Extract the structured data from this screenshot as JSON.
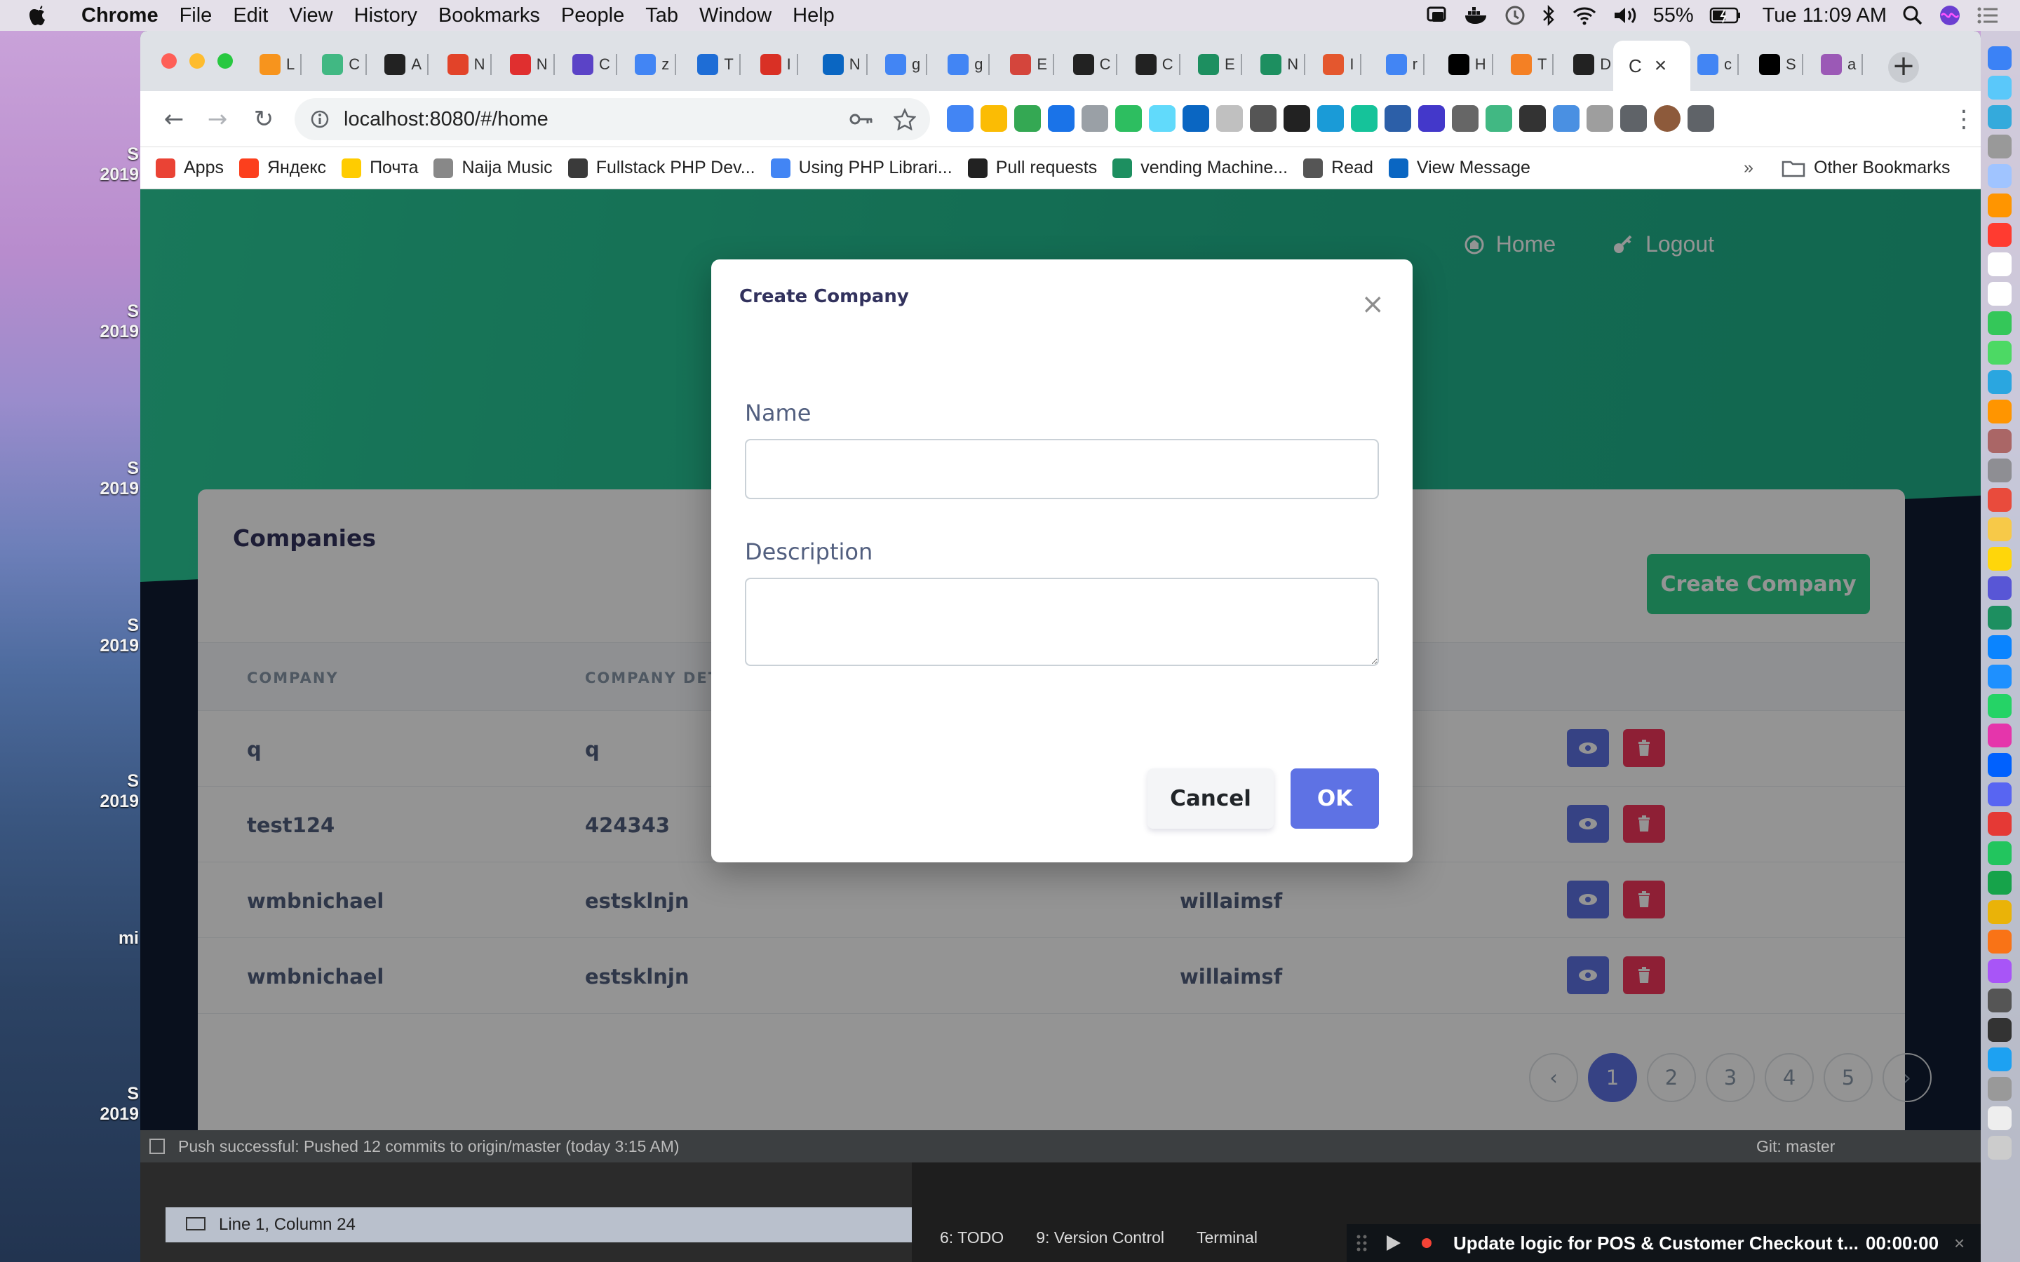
{
  "menubar": {
    "app": "Chrome",
    "items": [
      "File",
      "Edit",
      "View",
      "History",
      "Bookmarks",
      "People",
      "Tab",
      "Window",
      "Help"
    ],
    "battery": "55%",
    "clock": "Tue 11:09 AM"
  },
  "desktop_labels": [
    {
      "a": "S",
      "b": "2019"
    },
    {
      "a": "S",
      "b": "2019"
    },
    {
      "a": "S",
      "b": "2019"
    },
    {
      "a": "S",
      "b": "2019"
    },
    {
      "a": "S",
      "b": "2019"
    },
    {
      "a": "mi",
      "b": ""
    },
    {
      "a": "S",
      "b": "2019"
    }
  ],
  "tabs": [
    {
      "label": "L",
      "icon": "lf-icon",
      "color": "#f7941d"
    },
    {
      "label": "C",
      "icon": "vue-icon",
      "color": "#41b883"
    },
    {
      "label": "A",
      "icon": "bow-icon",
      "color": "#222222"
    },
    {
      "label": "N",
      "icon": "gitlab-icon",
      "color": "#e24329"
    },
    {
      "label": "N",
      "icon": "swirl-icon",
      "color": "#e02f2f"
    },
    {
      "label": "C",
      "icon": "list-icon",
      "color": "#5b43c7"
    },
    {
      "label": "z",
      "icon": "google-icon",
      "color": "#4285f4"
    },
    {
      "label": "T",
      "icon": "fastify-icon",
      "color": "#1e6dd6"
    },
    {
      "label": "I",
      "icon": "gmail-icon",
      "color": "#d93025"
    },
    {
      "label": "N",
      "icon": "linkedin-icon",
      "color": "#0a66c2"
    },
    {
      "label": "g",
      "icon": "google-icon",
      "color": "#4285f4"
    },
    {
      "label": "g",
      "icon": "google-icon",
      "color": "#4285f4"
    },
    {
      "label": "E",
      "icon": "flag-icon",
      "color": "#d4453c"
    },
    {
      "label": "C",
      "icon": "github-icon",
      "color": "#222222"
    },
    {
      "label": "C",
      "icon": "github-icon",
      "color": "#222222"
    },
    {
      "label": "E",
      "icon": "vuetify-icon",
      "color": "#1d8f60"
    },
    {
      "label": "N",
      "icon": "vuetify-icon",
      "color": "#1d8f60"
    },
    {
      "label": "I",
      "icon": "laravel-icon",
      "color": "#e4572e"
    },
    {
      "label": "r",
      "icon": "google-icon",
      "color": "#4285f4"
    },
    {
      "label": "H",
      "icon": "dev-icon",
      "color": "#000000"
    },
    {
      "label": "T",
      "icon": "stackoverflow-icon",
      "color": "#f48024"
    },
    {
      "label": "D",
      "icon": "github-icon",
      "color": "#222222"
    }
  ],
  "active_tab": {
    "label": "C"
  },
  "tabs_after": [
    {
      "label": "c",
      "icon": "google-icon",
      "color": "#4285f4"
    },
    {
      "label": "S",
      "icon": "medium-icon",
      "color": "#000000"
    },
    {
      "label": "a",
      "icon": "k-icon",
      "color": "#9b59b6"
    }
  ],
  "address": "localhost:8080/#/home",
  "extensions": [
    "#4285f4",
    "#fbbc04",
    "#34a853",
    "#1a73e8",
    "#9aa0a6",
    "#2dbe60",
    "#61dafb",
    "#0a66c2",
    "#c0c0c0",
    "#555555",
    "#222222",
    "#1a9bd7",
    "#15c39a",
    "#2c5fa8",
    "#4338ca",
    "#666666",
    "#41b883",
    "#333333",
    "#4a90e2",
    "#9e9e9e",
    "#5f6368",
    "#8d5a3b",
    "#5f6368"
  ],
  "bookmarks": [
    {
      "label": "Apps",
      "icon": "apps-grid-icon",
      "color": "#ea4335"
    },
    {
      "label": "Яндекс",
      "icon": "yandex-icon",
      "color": "#fc3f1d"
    },
    {
      "label": "Почта",
      "icon": "mail-icon",
      "color": "#ffcc00"
    },
    {
      "label": "Naija Music",
      "icon": "music-icon",
      "color": "#888888"
    },
    {
      "label": "Fullstack PHP Dev...",
      "icon": "job-icon",
      "color": "#3a3a3a"
    },
    {
      "label": "Using PHP Librari...",
      "icon": "gcloud-icon",
      "color": "#4285f4"
    },
    {
      "label": "Pull requests",
      "icon": "github-icon",
      "color": "#222222"
    },
    {
      "label": "vending Machine...",
      "icon": "vuetify-icon",
      "color": "#1d8f60"
    },
    {
      "label": "Read",
      "icon": "globe-icon",
      "color": "#555555"
    },
    {
      "label": "View Message",
      "icon": "linkedin-icon",
      "color": "#0a66c2"
    }
  ],
  "bookmarks_more": "»",
  "other_bookmarks": "Other Bookmarks",
  "nav": {
    "home": "Home",
    "logout": "Logout"
  },
  "card": {
    "title": "Companies",
    "create_button": "Create Company"
  },
  "table": {
    "headers": [
      "COMPANY",
      "COMPANY DETA",
      "",
      ""
    ],
    "rows": [
      {
        "company": "q",
        "details": "q",
        "owner": ""
      },
      {
        "company": "test124",
        "details": "424343",
        "owner": ""
      },
      {
        "company": "wmbnichael",
        "details": "estsklnjn",
        "owner": "willaimsf"
      },
      {
        "company": "wmbnichael",
        "details": "estsklnjn",
        "owner": "willaimsf"
      }
    ]
  },
  "pagination": {
    "prev": "‹",
    "pages": [
      "1",
      "2",
      "3",
      "4",
      "5"
    ],
    "current": "1",
    "next": "›"
  },
  "modal": {
    "title": "Create Company",
    "close": "×",
    "name_label": "Name",
    "name_value": "",
    "description_label": "Description",
    "description_value": "",
    "cancel": "Cancel",
    "ok": "OK"
  },
  "ide": {
    "status": "Push successful: Pushed 12 commits to origin/master (today 3:15 AM)",
    "git": "Git: master",
    "cursor": "Line 1, Column 24",
    "todo": "6: TODO",
    "vcs": "9: Version Control",
    "terminal": "Terminal",
    "task": "Update logic for POS & Customer Checkout t...",
    "time": "00:00:00"
  },
  "colors": {
    "accent": "#5e72e4",
    "success": "#2dce89",
    "danger": "#f5365c",
    "hero": "#2bcf9b"
  }
}
